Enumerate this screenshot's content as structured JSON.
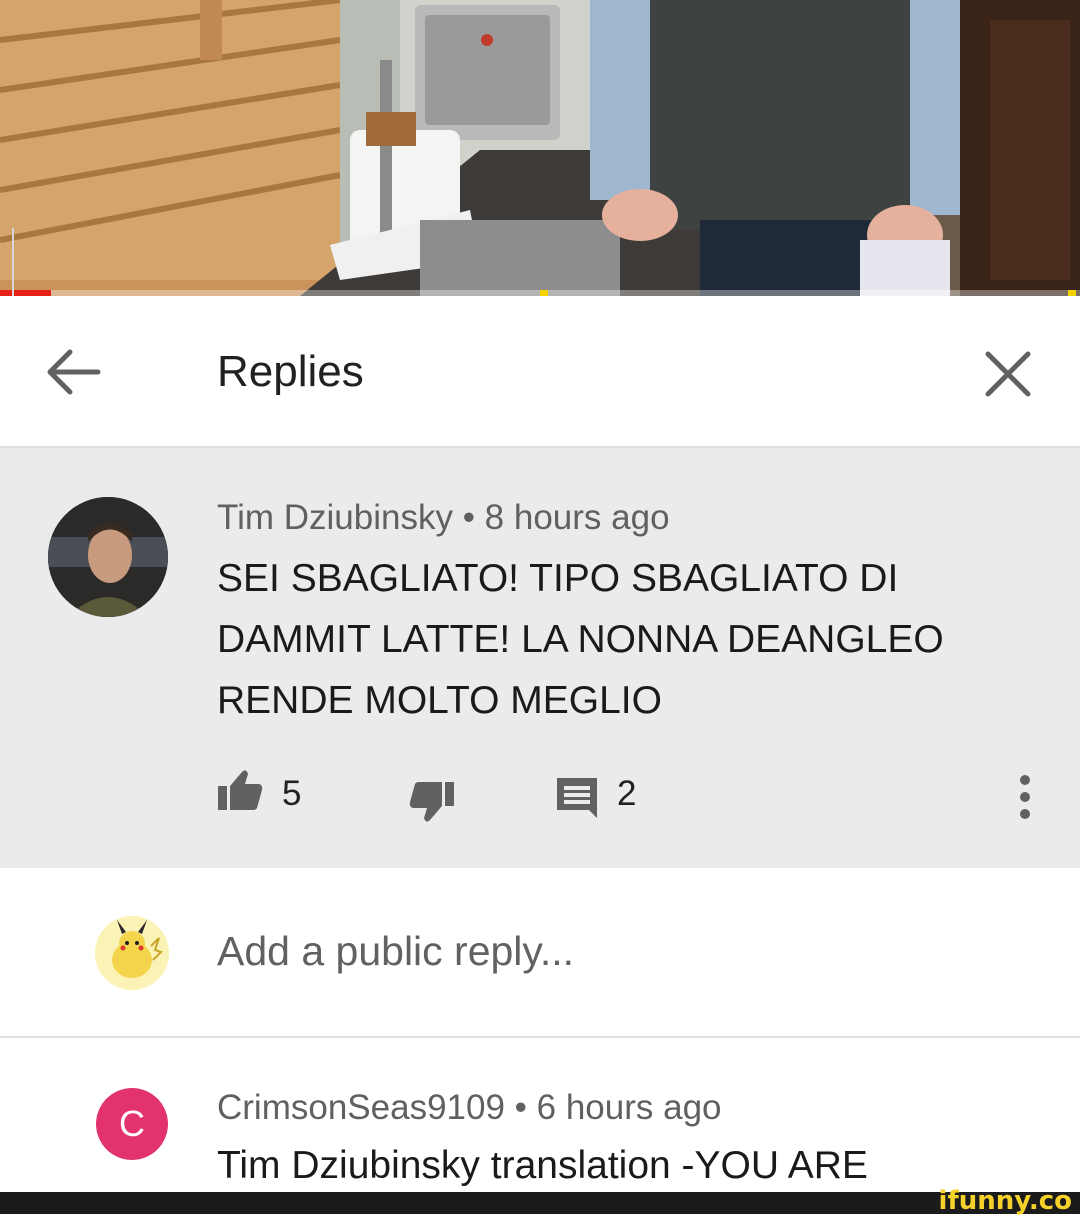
{
  "header": {
    "title": "Replies",
    "back_icon": "arrow-left-icon",
    "close_icon": "close-icon"
  },
  "video": {
    "progress_fraction": 0.047
  },
  "comment": {
    "author": "Tim Dziubinsky",
    "time": "8 hours ago",
    "separator": " • ",
    "text": "SEI SBAGLIATO! TIPO SBAGLIATO DI DAMMIT LATTE! LA NONNA DEANGLEO RENDE MOLTO MEGLIO",
    "likes": "5",
    "replies": "2"
  },
  "reply_box": {
    "placeholder": "Add a public reply..."
  },
  "second_comment": {
    "avatar_letter": "C",
    "author": "CrimsonSeas9109",
    "time": "6 hours ago",
    "separator": " • ",
    "text": "Tim Dziubinsky translation -YOU ARE"
  },
  "watermark": "ifunny.co",
  "colors": {
    "progress": "#e62117",
    "avatar_c": "#e3336c",
    "comment_bg": "#ebebeb",
    "watermark": "#f5d12a"
  }
}
